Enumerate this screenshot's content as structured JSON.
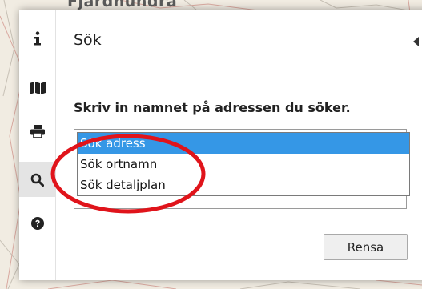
{
  "map": {
    "place_label": "Fjardhundra"
  },
  "nav": {
    "items": [
      {
        "name": "info",
        "icon": "info-icon",
        "active": false
      },
      {
        "name": "map",
        "icon": "map-icon",
        "active": false
      },
      {
        "name": "print",
        "icon": "printer-icon",
        "active": false
      },
      {
        "name": "search",
        "icon": "search-icon",
        "active": true
      },
      {
        "name": "help",
        "icon": "question-circle-icon",
        "active": false
      }
    ]
  },
  "panel": {
    "title": "Sök",
    "instruction": "Skriv in namnet på adressen du söker.",
    "search_type": {
      "selected": "Sök adress",
      "options": [
        "Sök adress",
        "Sök ortnamn",
        "Sök detaljplan"
      ]
    },
    "clear_label": "Rensa"
  },
  "colors": {
    "selected_option": "#3597e6",
    "annotation": "#e0141b",
    "active_nav": "#e4e4e4"
  }
}
